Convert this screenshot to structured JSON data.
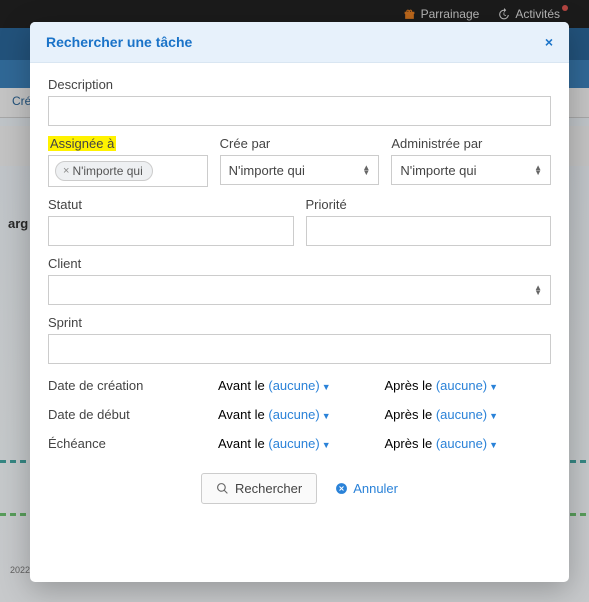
{
  "topbar": {
    "parrainage": "Parrainage",
    "activites": "Activités"
  },
  "bg": {
    "create_label": "Cré",
    "target": "arg"
  },
  "modal": {
    "title": "Rechercher une tâche",
    "description_label": "Description",
    "assigned_label": "Assignée à",
    "assigned_tag": "N'importe qui",
    "creee_label": "Crée par",
    "creee_value": "N'importe qui",
    "admin_label": "Administrée par",
    "admin_value": "N'importe qui",
    "statut_label": "Statut",
    "priorite_label": "Priorité",
    "client_label": "Client",
    "sprint_label": "Sprint",
    "date_creation": "Date de création",
    "date_debut": "Date de début",
    "echeance": "Échéance",
    "avant_le": "Avant le",
    "apres_le": "Après le",
    "aucune": "(aucune)",
    "btn_search": "Rechercher",
    "btn_cancel": "Annuler"
  }
}
